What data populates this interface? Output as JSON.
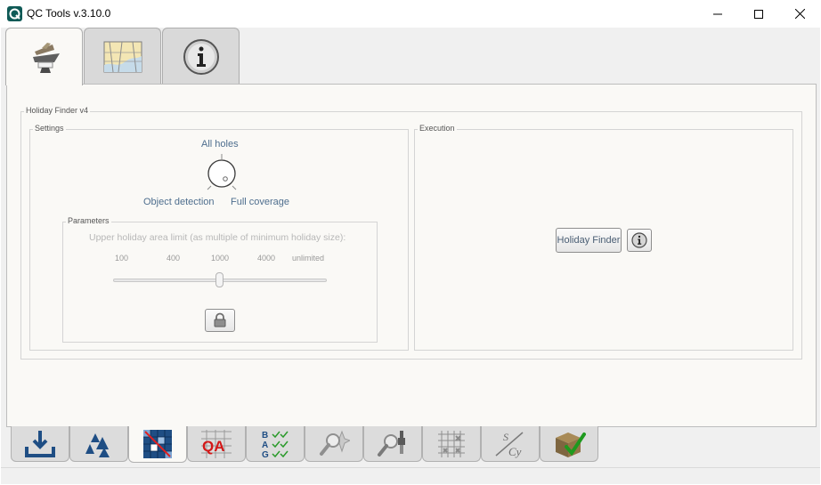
{
  "window": {
    "title": "QC Tools v.3.10.0"
  },
  "top_tabs": [
    {
      "icon": "ship-survey-icon",
      "active": true
    },
    {
      "icon": "chart-map-icon",
      "active": false
    },
    {
      "icon": "info-icon",
      "active": false
    }
  ],
  "tool": {
    "group_title": "Holiday Finder v4",
    "settings": {
      "title": "Settings",
      "mode_top": "All holes",
      "mode_left": "Object detection",
      "mode_right": "Full coverage"
    },
    "parameters": {
      "title": "Parameters",
      "limit_label": "Upper holiday area limit (as multiple of minimum holiday size):",
      "ticks": [
        "100",
        "400",
        "1000",
        "4000",
        "unlimited"
      ],
      "slider_index": 2
    },
    "execution": {
      "title": "Execution",
      "run_button": "Holiday Finder"
    }
  },
  "bottom_tabs": [
    {
      "icon": "download-icon",
      "active": false
    },
    {
      "icon": "triangles-icon",
      "active": false
    },
    {
      "icon": "grid-holiday-icon",
      "active": true
    },
    {
      "icon": "qa-icon",
      "active": false
    },
    {
      "icon": "bag-checklist-icon",
      "active": false
    },
    {
      "icon": "magnifier-star-icon",
      "active": false
    },
    {
      "icon": "magnifier-tool-icon",
      "active": false
    },
    {
      "icon": "grid-cross-icon",
      "active": false
    },
    {
      "icon": "s-cy-icon",
      "active": false
    },
    {
      "icon": "package-check-icon",
      "active": false
    }
  ]
}
